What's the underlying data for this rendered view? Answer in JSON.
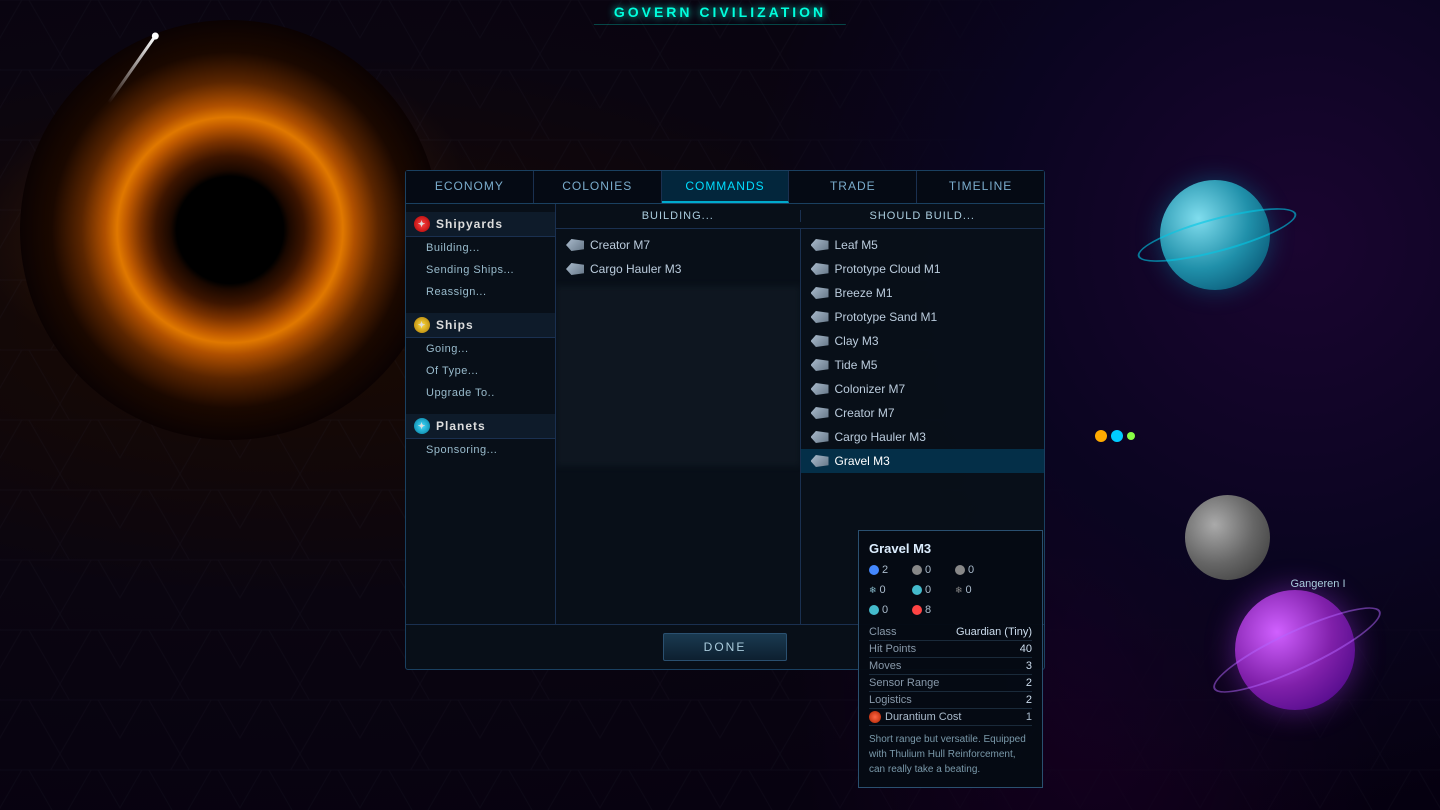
{
  "title": "Govern Civilization",
  "background": {
    "description": "Space background with black hole and nebula"
  },
  "panel": {
    "tabs": [
      {
        "label": "Economy",
        "active": false
      },
      {
        "label": "Colonies",
        "active": false
      },
      {
        "label": "Commands",
        "active": true
      },
      {
        "label": "Trade",
        "active": false
      },
      {
        "label": "Timeline",
        "active": false
      }
    ],
    "sidebar": {
      "sections": [
        {
          "header": "Shipyards",
          "icon_type": "red",
          "items": [
            "Building...",
            "Sending Ships...",
            "Reassign..."
          ]
        },
        {
          "header": "Ships",
          "icon_type": "yellow",
          "items": [
            "Going...",
            "Of Type...",
            "Upgrade To.."
          ]
        },
        {
          "header": "Planets",
          "icon_type": "teal",
          "items": [
            "Sponsoring..."
          ]
        }
      ]
    },
    "columns": {
      "building_header": "Building...",
      "should_build_header": "Should Build...",
      "building_items": [
        {
          "name": "Creator M7"
        },
        {
          "name": "Cargo Hauler M3"
        }
      ],
      "should_build_items": [
        {
          "name": "Leaf M5"
        },
        {
          "name": "Prototype Cloud M1"
        },
        {
          "name": "Breeze M1"
        },
        {
          "name": "Prototype Sand M1"
        },
        {
          "name": "Clay M3"
        },
        {
          "name": "Tide M5"
        },
        {
          "name": "Colonizer M7"
        },
        {
          "name": "Creator M7"
        },
        {
          "name": "Cargo Hauler M3"
        },
        {
          "name": "Gravel M3"
        }
      ]
    },
    "done_button": "Done"
  },
  "tooltip": {
    "title": "Gravel M3",
    "stats": {
      "attack": "2",
      "attack2": "0",
      "defense": "0",
      "defense2": "0",
      "shield": "0",
      "shield2": "0",
      "hp": "0",
      "hp2": "8"
    },
    "rows": [
      {
        "label": "Class",
        "value": "Guardian (Tiny)"
      },
      {
        "label": "Hit Points",
        "value": "40"
      },
      {
        "label": "Moves",
        "value": "3"
      },
      {
        "label": "Sensor Range",
        "value": "2"
      },
      {
        "label": "Logistics",
        "value": "2"
      }
    ],
    "durantium": {
      "label": "Durantium Cost",
      "value": "1"
    },
    "description": "Short range but versatile. Equipped with Thulium Hull Reinforcement, can really take a beating."
  },
  "map": {
    "planet_label": "Gangeren I"
  }
}
